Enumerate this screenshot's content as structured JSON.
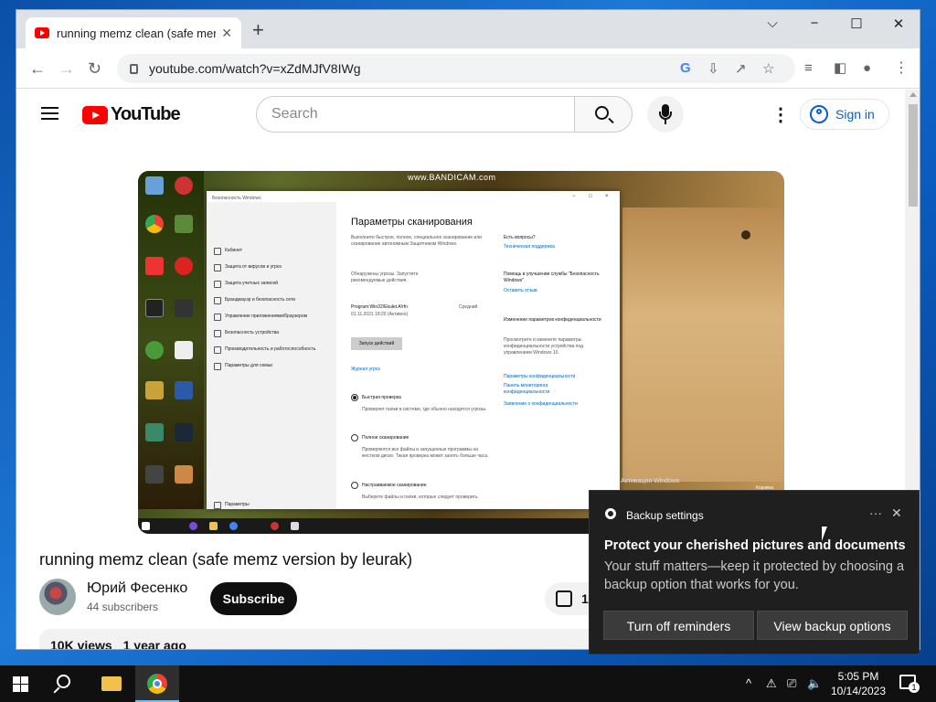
{
  "browser": {
    "tab_title": "running memz clean (safe memz",
    "tab_close": "✕",
    "new_tab": "+",
    "url": "youtube.com/watch?v=xZdMJfV8IWg",
    "minimize": "⌵",
    "restore": "−",
    "maximize": "☐",
    "close": "✕",
    "back": "←",
    "forward": "→",
    "reload": "↻"
  },
  "youtube": {
    "logo_text": "YouTube",
    "search_placeholder": "Search",
    "more": "⋮",
    "sign_in": "Sign in",
    "video_title": "running memz clean (safe memz version by leurak)",
    "channel_name": "Юрий Фесенко",
    "subscribers": "44 subscribers",
    "subscribe": "Subscribe",
    "likes": "1",
    "views": "10K views",
    "age": "1 year ago"
  },
  "video_frame": {
    "watermark": "www.BANDICAM.com",
    "window_title": "Безопасность Windows",
    "nav": [
      "Кабинет",
      "Защита от вирусов и угроз",
      "Защита учетных записей",
      "Брандмауэр и безопасность сети",
      "Управление приложениями/браузером",
      "Безопасность устройства",
      "Производительность и работоспособность",
      "Параметры для семьи"
    ],
    "settings": "Параметры",
    "heading": "Параметры сканирования",
    "intro": "Выполните быстрое, полное, специальное сканирование или сканирование автономным Защитником Windows.",
    "threats_found": "Обнаружены угрозы. Запустите рекомендуемые действия.",
    "threat_name": "Program:Win32/Ekulet.A!rfn",
    "threat_date": "01.11.2021 18:20 (Активно)",
    "threat_level": "Средний",
    "action_button": "Запуск действий",
    "log_link": "Журнал угроз",
    "options": [
      {
        "label": "Быстрая проверка",
        "desc": "Проверяет папки в системе, где обычно находятся угрозы."
      },
      {
        "label": "Полное сканирование",
        "desc": "Проверяются все файлы и запущенные программы на жестком диске. Такая проверка может занять больше часа."
      },
      {
        "label": "Настраиваемое сканирование",
        "desc": "Выберите файлы и папки, которые следует проверить."
      }
    ],
    "side_q": "Есть вопросы?",
    "side_help": "Техническая поддержка",
    "side_improve": "Помощь в улучшении службы \"Безопасность Windows\"",
    "side_feedback": "Оставить отзыв",
    "side_privacy": "Изменение параметров конфиденциальности",
    "side_privacy_text": "Просмотрите и измените параметры конфиденциальности устройства под управлением Windows 10.",
    "side_links": [
      "Параметры конфиденциальности",
      "Панель мониторинга конфиденциальности",
      "Заявление о конфиденциальности"
    ],
    "activate": "Активация Windows",
    "recycle": "Корзина"
  },
  "toast": {
    "app_name": "Backup settings",
    "more": "···",
    "close": "✕",
    "heading": "Protect your cherished pictures and documents",
    "body": "Your stuff matters—keep it protected by choosing a backup option that works for you.",
    "btn_dismiss": "Turn off reminders",
    "btn_view": "View backup options"
  },
  "taskbar": {
    "time": "5:05 PM",
    "date": "10/14/2023",
    "notification_count": "1",
    "tray_chevron": "^"
  }
}
